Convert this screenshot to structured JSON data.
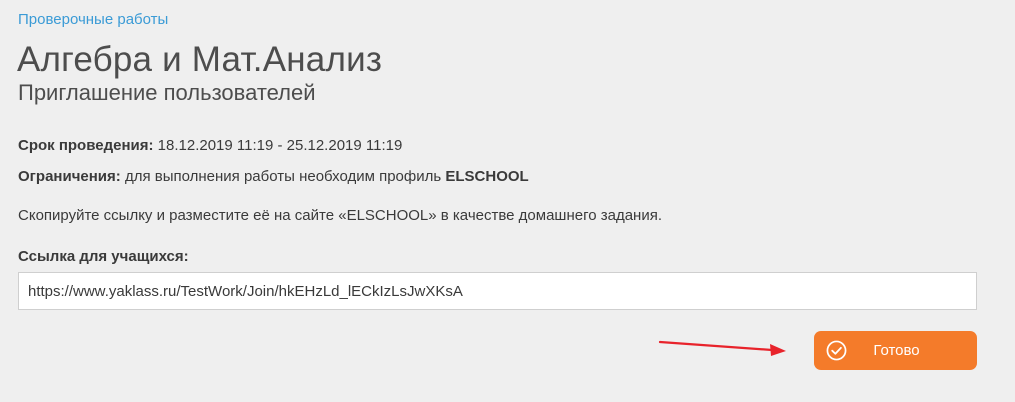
{
  "breadcrumb": "Проверочные работы",
  "title": "Алгебра и Мат.Анализ",
  "subtitle": "Приглашение пользователей",
  "deadline": {
    "label": "Срок проведения:",
    "value": "18.12.2019 11:19 - 25.12.2019 11:19"
  },
  "restrictions": {
    "label": "Ограничения:",
    "text": "для выполнения работы необходим профиль",
    "profile": "ELSCHOOL"
  },
  "instructions": "Скопируйте ссылку и разместите её на сайте «ELSCHOOL» в качестве домашнего задания.",
  "link": {
    "label": "Ссылка для учащихся:",
    "value": "https://www.yaklass.ru/TestWork/Join/hkEHzLd_lECkIzLsJwXKsA"
  },
  "done_button": {
    "label": "Готово",
    "icon": "check-circle-icon",
    "color": "#f47b2a"
  },
  "annotation": {
    "icon": "red-arrow-icon",
    "color": "#e8232b"
  }
}
